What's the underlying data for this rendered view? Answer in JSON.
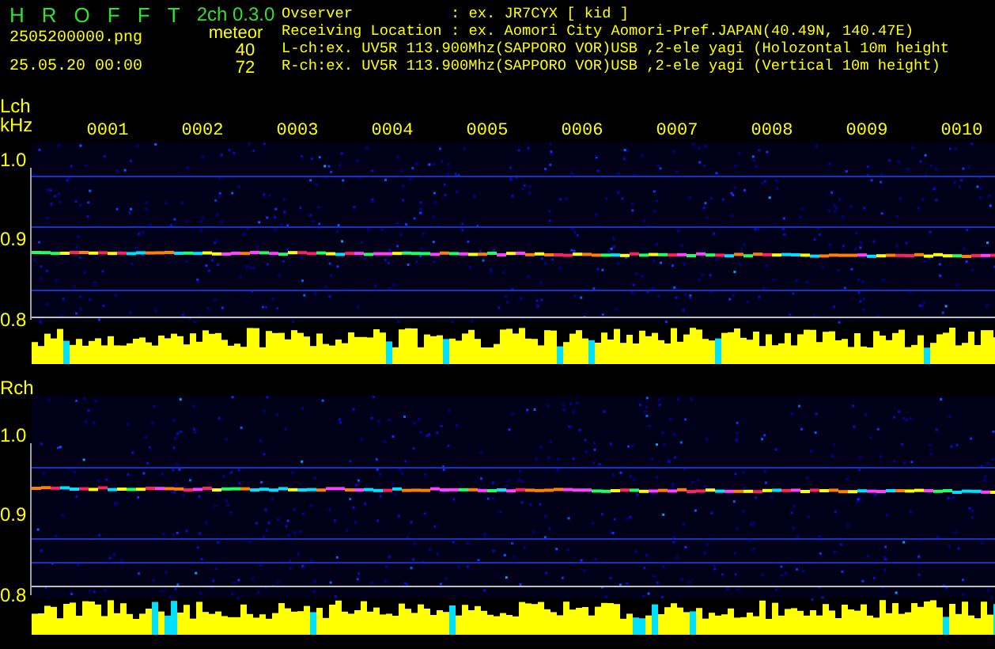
{
  "header": {
    "title_letters": [
      "H",
      "R",
      "O",
      "F",
      "F",
      "T"
    ],
    "version": "2ch 0.3.0",
    "file_name": "2505200000.png",
    "date_time": "25.05.20 00:00",
    "count_label": "meteor",
    "counts": [
      "40",
      "72"
    ]
  },
  "info": [
    {
      "label": "Ovserver",
      "value": ": ex. JR7CYX [ kid ]"
    },
    {
      "label": "Receiving Location",
      "value": ": ex. Aomori City Aomori-Pref.JAPAN(40.49N, 140.47E)"
    }
  ],
  "channel_lines": [
    "L-ch:ex. UV5R 113.900Mhz(SAPPORO VOR)USB ,2-ele yagi (Holozontal 10m height",
    "R-ch:ex. UV5R 113.900Mhz(SAPPORO VOR)USB ,2-ele yagi (Vertical 10m height)"
  ],
  "time_labels": [
    "0001",
    "0002",
    "0003",
    "0004",
    "0005",
    "0006",
    "0007",
    "0008",
    "0009",
    "0010"
  ],
  "channels": [
    {
      "kind": "left",
      "label": "Lch",
      "unit": "kHz",
      "yticks": [
        "1.0",
        "0.9",
        "0.8"
      ]
    },
    {
      "kind": "right",
      "label": "Rch",
      "yticks": [
        "1.0",
        "0.9",
        "0.8"
      ]
    }
  ]
}
